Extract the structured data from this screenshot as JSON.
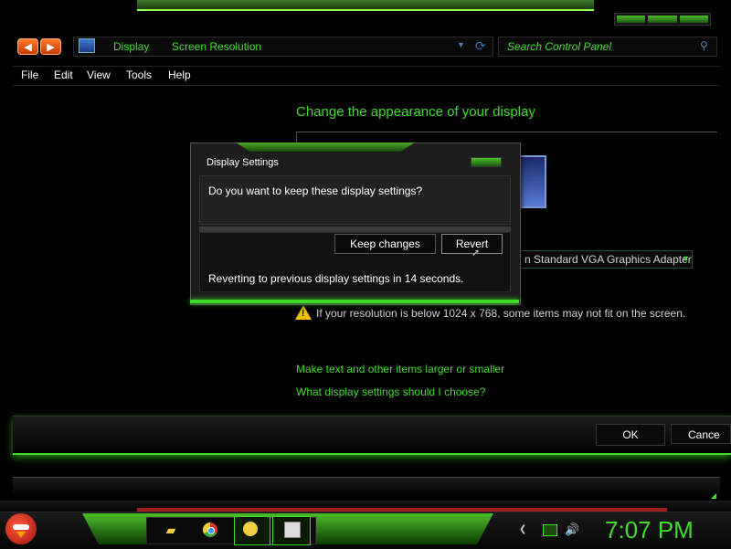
{
  "window": {
    "breadcrumb": [
      "Display",
      "Screen Resolution"
    ],
    "search_placeholder": "Search Control Panel",
    "nav_back": "◀",
    "nav_forward": "▶"
  },
  "menu": [
    "File",
    "Edit",
    "View",
    "Tools",
    "Help"
  ],
  "content": {
    "heading": "Change the appearance of your display",
    "adapter_value": "n Standard VGA Graphics Adapter",
    "warning": "If your resolution is below 1024 x 768, some items may not fit on the screen.",
    "links": [
      "Make text and other items larger or smaller",
      "What display settings should I choose?"
    ]
  },
  "buttons": {
    "ok": "OK",
    "cancel": "Cance"
  },
  "dialog": {
    "title": "Display Settings",
    "question": "Do you want to keep these display settings?",
    "keep_label": "Keep changes",
    "revert_label": "Revert",
    "countdown_text": "Reverting to previous display settings in 14 seconds."
  },
  "taskbar": {
    "clock": "7:07 PM",
    "icons": [
      "folder-icon",
      "chrome-icon",
      "messenger-icon",
      "control-panel-icon"
    ]
  },
  "colors": {
    "accent": "#3fdc2a",
    "nav_buttons": "#ff7a2a",
    "background": "#000000"
  }
}
